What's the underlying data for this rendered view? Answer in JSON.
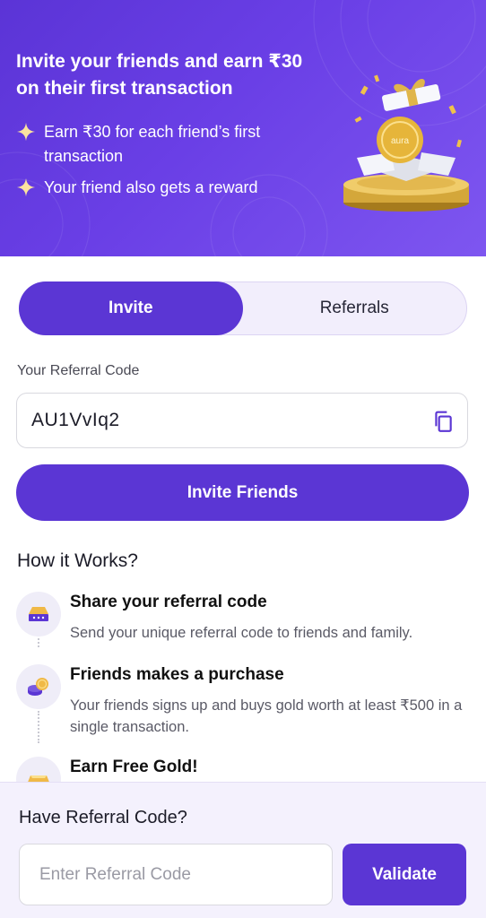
{
  "hero": {
    "title": "Invite your friends and earn ₹30 on their first transaction",
    "points": [
      "Earn ₹30 for each friend’s first transaction",
      "Your friend also gets a reward"
    ],
    "coin_text": "aura"
  },
  "tabs": [
    {
      "label": "Invite",
      "active": true
    },
    {
      "label": "Referrals",
      "active": false
    }
  ],
  "referral": {
    "label": "Your Referral Code",
    "code": "AU1VvIq2"
  },
  "invite_button": "Invite Friends",
  "how_it_works": {
    "title": "How it Works?",
    "steps": [
      {
        "title": "Share your referral code",
        "desc": "Send your unique referral code to friends and family.",
        "icon": "ticket-icon"
      },
      {
        "title": "Friends makes a purchase",
        "desc": "Your friends signs up and buys gold worth at least ₹500 in a single transaction.",
        "icon": "coin-stack-icon"
      },
      {
        "title": "Earn Free Gold!",
        "desc": "",
        "icon": "gold-bar-icon"
      }
    ]
  },
  "have_code": {
    "title": "Have Referral Code?",
    "placeholder": "Enter Referral Code",
    "button": "Validate"
  },
  "colors": {
    "primary": "#5b36d4",
    "hero_bg": "#6a3fe6",
    "gold": "#e6b53a",
    "bottom_bg": "#f4f1fd"
  }
}
